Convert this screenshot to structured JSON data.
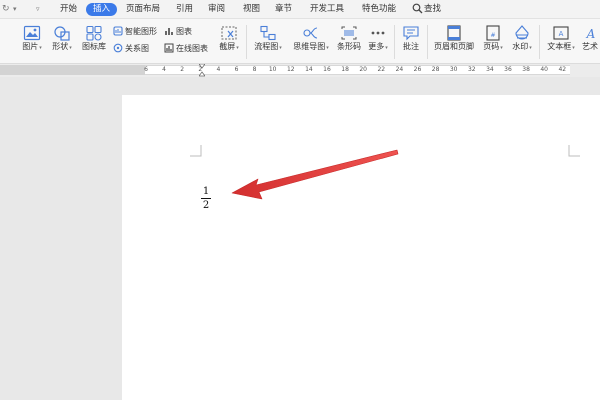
{
  "menu": {
    "quick_access": [
      "↻",
      "▾",
      "▿"
    ],
    "tabs": [
      "开始",
      "插入",
      "页面布局",
      "引用",
      "审阅",
      "视图",
      "章节",
      "开发工具",
      "特色功能"
    ],
    "active_tab": "插入",
    "search_label": "查找"
  },
  "ribbon": {
    "items": {
      "picture": "图片",
      "shape": "形状",
      "icon_lib": "图标库",
      "smart_art": "智能图形",
      "relation": "关系图",
      "chart": "图表",
      "online_chart": "在线图表",
      "screenshot": "截屏",
      "flowchart": "流程图",
      "mindmap": "思维导图",
      "barcode": "条形码",
      "more": "更多",
      "comment": "批注",
      "header_footer": "页眉和页脚",
      "page_num": "页码",
      "watermark": "水印",
      "textbox": "文本框",
      "art": "艺术"
    }
  },
  "ruler": {
    "ticks": [
      "6",
      "4",
      "2",
      "2",
      "4",
      "6",
      "8",
      "10",
      "12",
      "14",
      "16",
      "18",
      "20",
      "22",
      "24",
      "26",
      "28",
      "30",
      "32",
      "34",
      "36",
      "38",
      "40",
      "42"
    ]
  },
  "document": {
    "fraction_numerator": "1",
    "fraction_denominator": "2",
    "colors": {
      "arrow": "#e53935",
      "accent": "#3b7ae9"
    }
  }
}
